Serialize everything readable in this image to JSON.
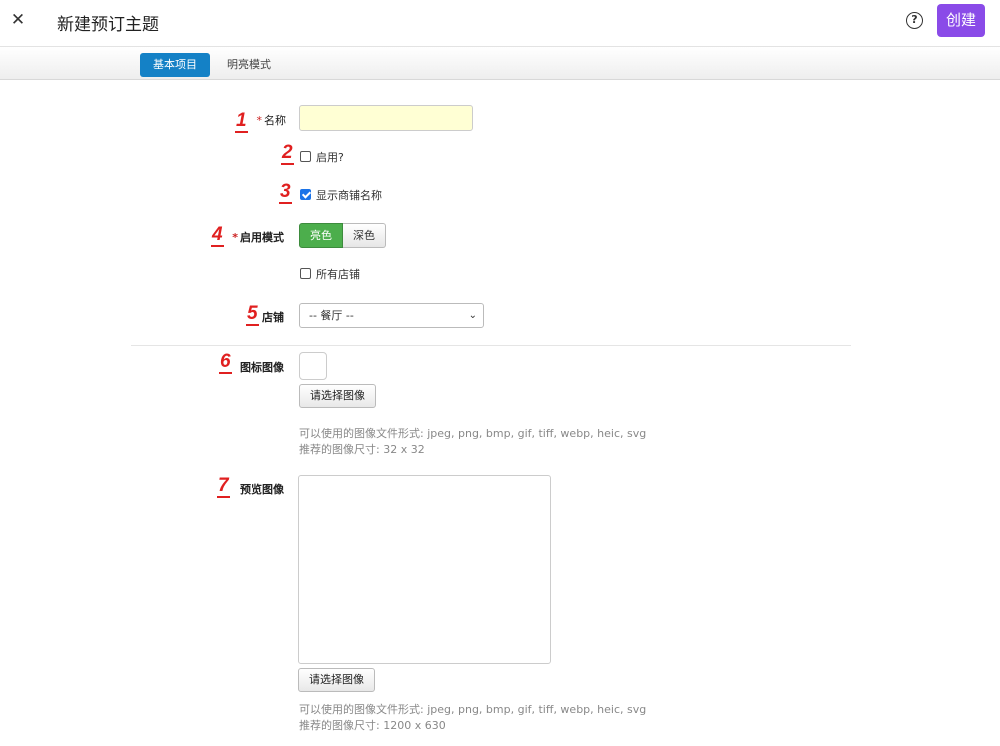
{
  "header": {
    "close_glyph": "✕",
    "title": "新建预订主题",
    "help_glyph": "?",
    "create_label": "创建",
    "accent_color": "#8a4be8"
  },
  "tabs": [
    {
      "label": "基本项目",
      "active": true
    },
    {
      "label": "明亮模式",
      "active": false
    }
  ],
  "markers": [
    "1",
    "2",
    "3",
    "4",
    "5",
    "6",
    "7"
  ],
  "form": {
    "name": {
      "required_mark": "*",
      "label": "名称",
      "value": ""
    },
    "enabled": {
      "label": "启用?",
      "checked": false
    },
    "show_store_name": {
      "label": "显示商铺名称",
      "checked": true
    },
    "mode": {
      "required_mark": "*",
      "label": "启用模式",
      "options": [
        "亮色",
        "深色"
      ],
      "selected": "亮色"
    },
    "all_stores": {
      "label": "所有店铺",
      "checked": false
    },
    "store": {
      "label": "店铺",
      "selected": "-- 餐厅 --"
    },
    "icon_image": {
      "label": "图标图像",
      "button": "请选择图像",
      "formats": "可以使用的图像文件形式: jpeg, png, bmp, gif, tiff, webp, heic, svg",
      "size": "推荐的图像尺寸: 32 x 32"
    },
    "preview_image": {
      "label": "预览图像",
      "button": "请选择图像",
      "formats": "可以使用的图像文件形式: jpeg, png, bmp, gif, tiff, webp, heic, svg",
      "size": "推荐的图像尺寸: 1200 x 630"
    }
  }
}
